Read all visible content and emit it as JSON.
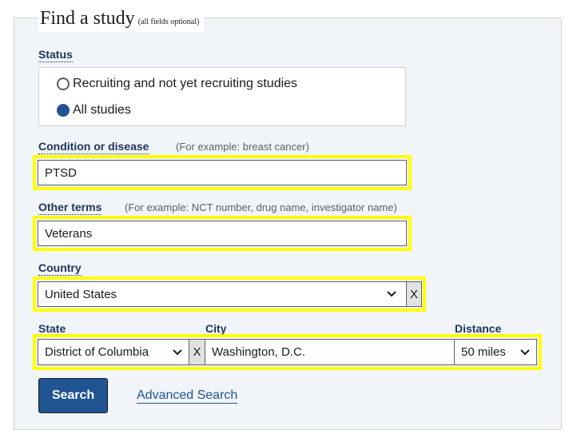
{
  "form": {
    "title": "Find a study",
    "subtitle": "(all fields optional)"
  },
  "status": {
    "label": "Status",
    "options": [
      {
        "label": "Recruiting and not yet recruiting studies",
        "checked": false
      },
      {
        "label": "All studies",
        "checked": true
      }
    ]
  },
  "condition": {
    "label": "Condition or disease",
    "hint": "(For example: breast cancer)",
    "value": "PTSD"
  },
  "other_terms": {
    "label": "Other terms",
    "hint": "(For example: NCT number, drug name, investigator name)",
    "value": "Veterans"
  },
  "country": {
    "label": "Country",
    "selected": "United States",
    "clear_label": "X"
  },
  "state": {
    "label": "State",
    "selected": "District of Columbia",
    "clear_label": "X"
  },
  "city": {
    "label": "City",
    "value": "Washington, D.C."
  },
  "distance": {
    "label": "Distance",
    "selected": "50 miles"
  },
  "actions": {
    "search_label": "Search",
    "advanced_label": "Advanced Search"
  },
  "colors": {
    "accent": "#205493",
    "highlight": "#ffff00",
    "panel_bg": "#f1f4f9",
    "label": "#1c3559"
  }
}
